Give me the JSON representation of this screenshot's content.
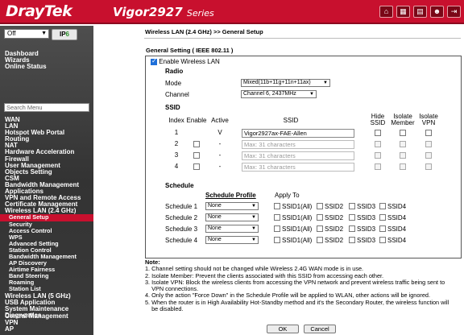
{
  "header": {
    "logo": "DrayTek",
    "model": "Vigor2927",
    "series": "Series",
    "icons": [
      "home-icon",
      "grid-icon",
      "clipboard-icon",
      "user-icon",
      "logout-icon"
    ]
  },
  "sidebar": {
    "mode_select": "Off",
    "ipv6_prefix": "IP",
    "ipv6_suffix": "6",
    "top_links": [
      "Dashboard",
      "Wizards",
      "Online Status"
    ],
    "search_placeholder": "Search Menu",
    "menu": [
      {
        "label": "WAN",
        "sub": false
      },
      {
        "label": "LAN",
        "sub": false
      },
      {
        "label": "Hotspot Web Portal",
        "sub": false
      },
      {
        "label": "Routing",
        "sub": false
      },
      {
        "label": "NAT",
        "sub": false
      },
      {
        "label": "Hardware Acceleration",
        "sub": false
      },
      {
        "label": "Firewall",
        "sub": false
      },
      {
        "label": "User Management",
        "sub": false
      },
      {
        "label": "Objects Setting",
        "sub": false
      },
      {
        "label": "CSM",
        "sub": false
      },
      {
        "label": "Bandwidth Management",
        "sub": false
      },
      {
        "label": "Applications",
        "sub": false
      },
      {
        "label": "VPN and Remote Access",
        "sub": false
      },
      {
        "label": "Certificate Management",
        "sub": false
      },
      {
        "label": "Wireless LAN (2.4 GHz)",
        "sub": false
      },
      {
        "label": "General Setup",
        "sub": true,
        "active": true
      },
      {
        "label": "Security",
        "sub": true
      },
      {
        "label": "Access Control",
        "sub": true
      },
      {
        "label": "WPS",
        "sub": true
      },
      {
        "label": "Advanced Setting",
        "sub": true
      },
      {
        "label": "Station Control",
        "sub": true
      },
      {
        "label": "Bandwidth Management",
        "sub": true
      },
      {
        "label": "AP Discovery",
        "sub": true
      },
      {
        "label": "Airtime Fairness",
        "sub": true
      },
      {
        "label": "Band Steering",
        "sub": true
      },
      {
        "label": "Roaming",
        "sub": true
      },
      {
        "label": "Station List",
        "sub": true
      },
      {
        "label": "Wireless LAN (5 GHz)",
        "sub": false
      },
      {
        "label": "USB Application",
        "sub": false
      },
      {
        "label": "System Maintenance",
        "sub": false
      },
      {
        "label": "Diagnostics",
        "sub": false
      }
    ],
    "bottom": [
      "Central Management",
      "VPN",
      "AP"
    ]
  },
  "main": {
    "breadcrumb": "Wireless LAN (2.4 GHz) >> General Setup",
    "section_title": "General Setting ( IEEE 802.11 )",
    "enable_label": "Enable Wireless LAN",
    "radio": {
      "title": "Radio",
      "mode_label": "Mode",
      "mode_value": "Mixed(11b+11g+11n+11ax)",
      "channel_label": "Channel",
      "channel_value": "Channel 6, 2437MHz"
    },
    "ssid": {
      "title": "SSID",
      "headers": {
        "index": "Index",
        "enable": "Enable",
        "active": "Active",
        "ssid": "SSID",
        "hide1": "Hide",
        "hide2": "SSID",
        "iso1": "Isolate",
        "iso2": "Member",
        "vpn1": "Isolate",
        "vpn2": "VPN"
      },
      "rows": [
        {
          "index": "1",
          "active": "V",
          "value": "Vigor2927ax-FAE-Allen",
          "placeholder": ""
        },
        {
          "index": "2",
          "active": "-",
          "value": "",
          "placeholder": "Max: 31 characters"
        },
        {
          "index": "3",
          "active": "-",
          "value": "",
          "placeholder": "Max: 31 characters"
        },
        {
          "index": "4",
          "active": "-",
          "value": "",
          "placeholder": "Max: 31 characters"
        }
      ]
    },
    "schedule": {
      "title": "Schedule",
      "profile_header": "Schedule Profile",
      "apply_header": "Apply To",
      "rows": [
        {
          "label": "Schedule 1",
          "value": "None"
        },
        {
          "label": "Schedule 2",
          "value": "None"
        },
        {
          "label": "Schedule 3",
          "value": "None"
        },
        {
          "label": "Schedule 4",
          "value": "None"
        }
      ],
      "apply_options": [
        "SSID1(All)",
        "SSID2",
        "SSID3",
        "SSID4"
      ]
    },
    "note": {
      "title": "Note:",
      "items": [
        "1. Channel setting should not be changed while Wireless 2.4G WAN mode is in use.",
        "2. Isolate Member: Prevent the clients associated with this SSID from accessing each other.",
        "3. Isolate VPN: Block the wireless clients from accessing the VPN network and prevent wireless traffic being sent to",
        "    VPN connections.",
        "4. Only the action \"Force Down\" in the Schedule Profile will be applied to WLAN, other actions will be ignored.",
        "5. When the router is in High Availability Hot-Standby method and it's the Secondary Router, the wireless function will",
        "    be disabled."
      ]
    },
    "buttons": {
      "ok": "OK",
      "cancel": "Cancel"
    }
  }
}
